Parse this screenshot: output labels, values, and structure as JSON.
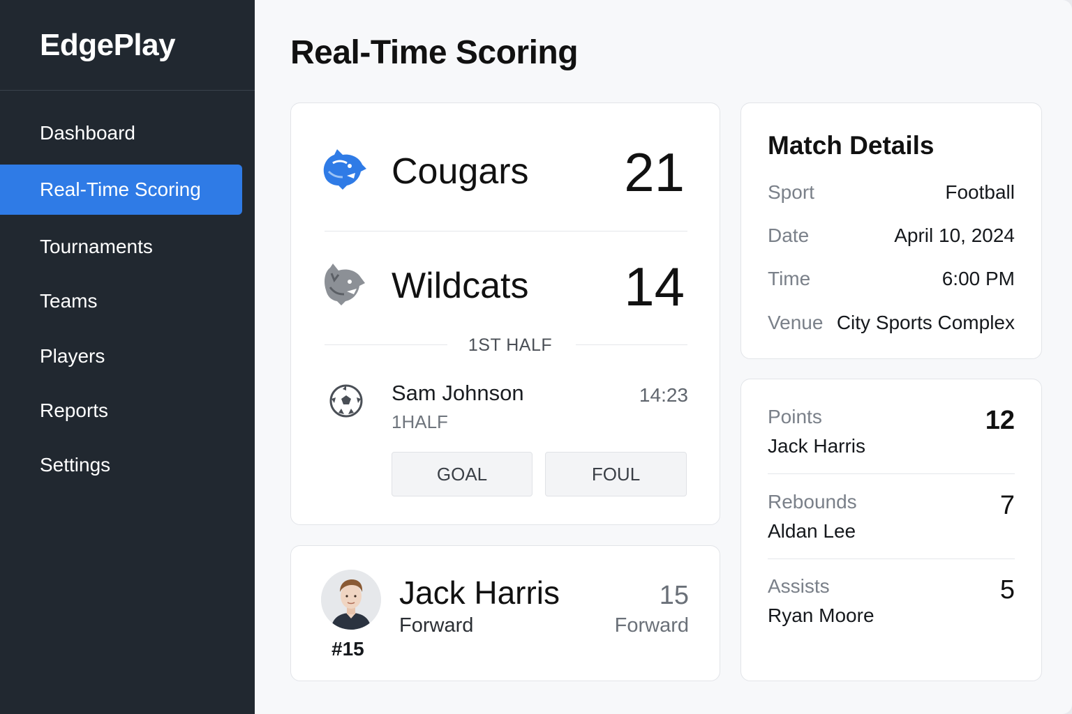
{
  "app": {
    "brand": "EdgePlay"
  },
  "sidebar": {
    "items": [
      {
        "label": "Dashboard",
        "active": false
      },
      {
        "label": "Real-Time Scoring",
        "active": true
      },
      {
        "label": "Tournaments",
        "active": false
      },
      {
        "label": "Teams",
        "active": false
      },
      {
        "label": "Players",
        "active": false
      },
      {
        "label": "Reports",
        "active": false
      },
      {
        "label": "Settings",
        "active": false
      }
    ]
  },
  "main": {
    "title": "Real-Time Scoring"
  },
  "scoreboard": {
    "home": {
      "name": "Cougars",
      "score": "21",
      "logo": "cougar-icon",
      "color": "#2f7be6"
    },
    "away": {
      "name": "Wildcats",
      "score": "14",
      "logo": "wildcat-icon",
      "color": "#8c9096"
    },
    "period": "1ST HALF",
    "event": {
      "player": "Sam Johnson",
      "period": "1HALF",
      "time": "14:23",
      "icon": "soccer-ball-icon"
    },
    "actions": {
      "goal": "GOAL",
      "foul": "FOUL"
    }
  },
  "player_card": {
    "name": "Jack Harris",
    "position": "Forward",
    "number": "15",
    "position_secondary": "Forward",
    "jersey": "#15"
  },
  "match_details": {
    "title": "Match Details",
    "rows": [
      {
        "label": "Sport",
        "value": "Football"
      },
      {
        "label": "Date",
        "value": "April 10, 2024"
      },
      {
        "label": "Time",
        "value": "6:00 PM"
      },
      {
        "label": "Venue",
        "value": "City Sports Complex"
      }
    ]
  },
  "leaders": [
    {
      "label": "Points",
      "player": "Jack Harris",
      "value": "12"
    },
    {
      "label": "Rebounds",
      "player": "Aldan Lee",
      "value": "7"
    },
    {
      "label": "Assists",
      "player": "Ryan Moore",
      "value": "5"
    }
  ],
  "colors": {
    "sidebar": "#212830",
    "accent": "#2f7be6",
    "background": "#f7f8fa"
  }
}
